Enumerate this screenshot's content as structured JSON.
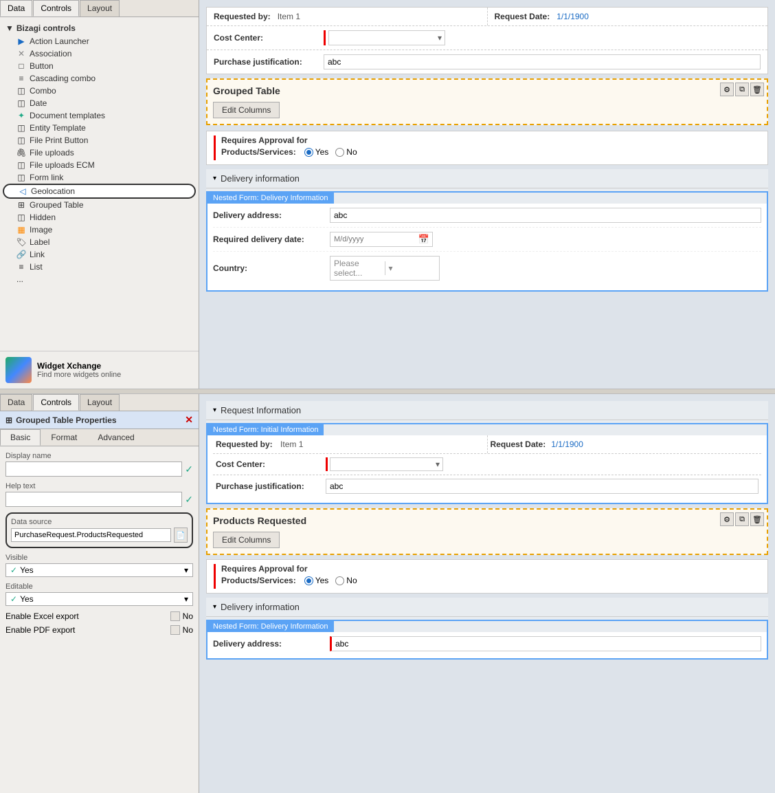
{
  "top": {
    "tabs": [
      "Data",
      "Controls",
      "Layout"
    ],
    "active_tab": "Controls",
    "tree": {
      "header": "Bizagi controls",
      "items": [
        {
          "id": "action-launcher",
          "label": "Action Launcher",
          "icon": "arrow-right"
        },
        {
          "id": "association",
          "label": "Association",
          "icon": "cross"
        },
        {
          "id": "button",
          "label": "Button",
          "icon": "square"
        },
        {
          "id": "cascading-combo",
          "label": "Cascading combo",
          "icon": "lines"
        },
        {
          "id": "combo",
          "label": "Combo",
          "icon": "square-small"
        },
        {
          "id": "date",
          "label": "Date",
          "icon": "square-small"
        },
        {
          "id": "document-templates",
          "label": "Document templates",
          "icon": "doc-green"
        },
        {
          "id": "entity-template",
          "label": "Entity Template",
          "icon": "square-small"
        },
        {
          "id": "file-print-button",
          "label": "File Print Button",
          "icon": "square-small"
        },
        {
          "id": "file-uploads",
          "label": "File uploads",
          "icon": "paperclip"
        },
        {
          "id": "file-uploads-ecm",
          "label": "File uploads ECM",
          "icon": "square-small"
        },
        {
          "id": "form-link",
          "label": "Form link",
          "icon": "square-small"
        },
        {
          "id": "geolocation",
          "label": "Geolocation",
          "icon": "geo",
          "highlighted": true
        },
        {
          "id": "grouped-table",
          "label": "Grouped Table",
          "icon": "table"
        },
        {
          "id": "hidden",
          "label": "Hidden",
          "icon": "square-small"
        },
        {
          "id": "image",
          "label": "Image",
          "icon": "image"
        },
        {
          "id": "label",
          "label": "Label",
          "icon": "tag"
        },
        {
          "id": "link",
          "label": "Link",
          "icon": "link"
        },
        {
          "id": "list",
          "label": "List",
          "icon": "list"
        }
      ]
    },
    "widget_xchange": {
      "title": "Widget Xchange",
      "subtitle": "Find more widgets online"
    }
  },
  "top_right": {
    "requested_by_label": "Requested by:",
    "requested_by_value": "Item 1",
    "request_date_label": "Request Date:",
    "request_date_value": "1/1/1900",
    "cost_center_label": "Cost Center:",
    "purchase_justification_label": "Purchase justification:",
    "purchase_justification_value": "abc",
    "grouped_table_title": "Grouped Table",
    "edit_columns_btn": "Edit Columns",
    "requires_approval_label": "Requires Approval for",
    "products_services_label": "Products/Services:",
    "yes_label": "Yes",
    "no_label": "No",
    "delivery_section_title": "Delivery information",
    "nested_form_label": "Nested Form: Delivery Information",
    "delivery_address_label": "Delivery address:",
    "delivery_address_value": "abc",
    "required_delivery_date_label": "Required delivery date:",
    "required_delivery_date_placeholder": "M/d/yyyy",
    "country_label": "Country:",
    "country_placeholder": "Please select..."
  },
  "bottom": {
    "tabs": [
      "Data",
      "Controls",
      "Layout"
    ],
    "active_tab": "Controls",
    "properties_title": "Grouped Table Properties",
    "close_btn": "✕",
    "props_tabs": [
      "Basic",
      "Format",
      "Advanced"
    ],
    "active_props_tab": "Basic",
    "fields": {
      "display_name_label": "Display name",
      "display_name_value": "",
      "help_text_label": "Help text",
      "help_text_value": "",
      "data_source_label": "Data source",
      "data_source_value": "PurchaseRequest.ProductsRequested",
      "visible_label": "Visible",
      "visible_value": "Yes",
      "editable_label": "Editable",
      "editable_value": "Yes",
      "enable_excel_export_label": "Enable Excel export",
      "enable_excel_export_value": "No",
      "enable_pdf_export_label": "Enable PDF export",
      "enable_pdf_export_value": "No"
    }
  },
  "bottom_right": {
    "request_info_title": "Request Information",
    "nested_initial_label": "Nested Form: Initial Information",
    "requested_by_label": "Requested by:",
    "requested_by_value": "Item 1",
    "request_date_label": "Request Date:",
    "request_date_value": "1/1/1900",
    "cost_center_label": "Cost Center:",
    "purchase_justification_label": "Purchase justification:",
    "purchase_justification_value": "abc",
    "products_requested_title": "Products Requested",
    "edit_columns_btn": "Edit Columns",
    "requires_approval_label": "Requires Approval for",
    "products_services_label": "Products/Services:",
    "yes_label": "Yes",
    "no_label": "No",
    "delivery_section_title": "Delivery information",
    "nested_delivery_label": "Nested Form: Delivery Information",
    "delivery_address_label": "Delivery address:",
    "delivery_address_value": "abc"
  }
}
